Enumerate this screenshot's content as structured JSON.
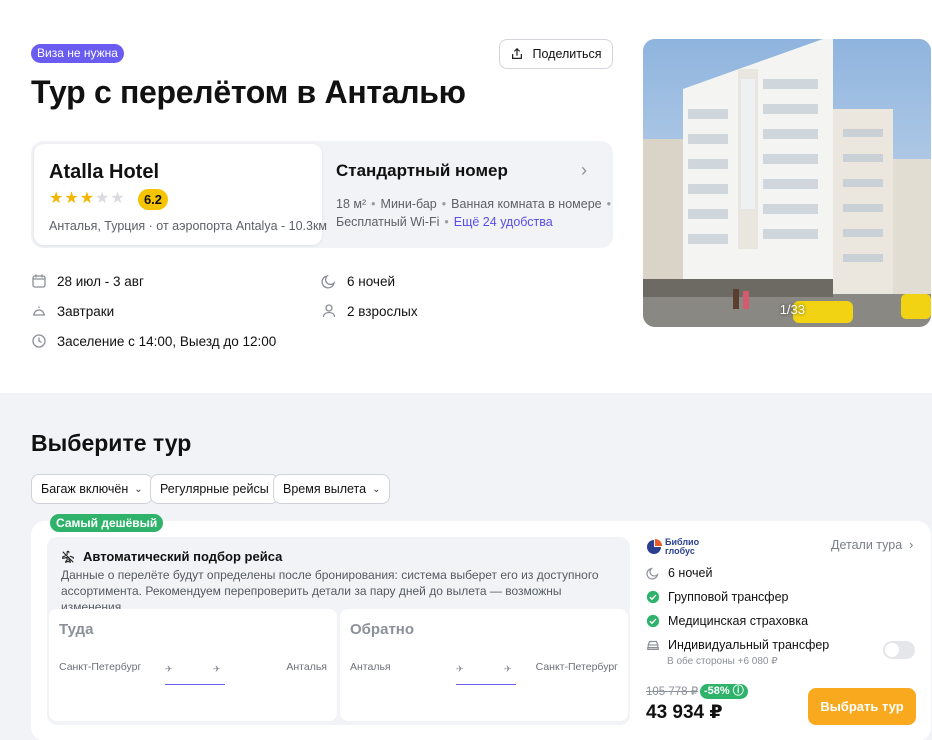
{
  "header": {
    "visa_badge": "Виза не нужна",
    "share_label": "Поделиться",
    "title": "Тур с перелётом в Анталью"
  },
  "hotel": {
    "name": "Atalla Hotel",
    "stars": 3,
    "stars_max": 5,
    "rating": "6.2",
    "location": "Анталья, Турция · от аэропорта Antalya - 10.3км"
  },
  "room": {
    "title": "Стандартный номер",
    "amenities_line1": [
      "18 м²",
      "Мини-бар",
      "Ванная комната в номере"
    ],
    "amenities_line2_text": "Бесплатный Wi-Fi",
    "more_amenities": "Ещё 24 удобства"
  },
  "trip": {
    "dates": "28 июл - 3 авг",
    "nights": "6 ночей",
    "meals": "Завтраки",
    "guests": "2 взрослых",
    "checkin": "Заселение с 14:00, Выезд до 12:00"
  },
  "photo": {
    "counter": "1/33"
  },
  "tours": {
    "section_title": "Выберите тур",
    "filters": [
      {
        "label": "Багаж включён",
        "has_dropdown": true
      },
      {
        "label": "Регулярные рейсы",
        "has_dropdown": false
      },
      {
        "label": "Время вылета",
        "has_dropdown": true
      }
    ],
    "card": {
      "badge": "Самый дешёвый",
      "flight_title": "Автоматический подбор рейса",
      "flight_desc": "Данные о перелёте будут определены после бронирования: система выберет его из доступного ассортимента. Рекомендуем перепроверить детали за пару дней до вылета — возможны изменения.",
      "legs": [
        {
          "title": "Туда",
          "from": "Санкт-Петербург",
          "to": "Анталья"
        },
        {
          "title": "Обратно",
          "from": "Анталья",
          "to": "Санкт-Петербург"
        }
      ],
      "operator_logo_line1": "Библио",
      "operator_logo_line2": "глобус",
      "details_link": "Детали тура",
      "features": [
        {
          "label": "6 ночей",
          "icon": "moon-icon"
        },
        {
          "label": "Групповой трансфер",
          "icon": "check-icon"
        },
        {
          "label": "Медицинская страховка",
          "icon": "check-icon"
        }
      ],
      "individual_transfer": "Индивидуальный трансфер",
      "individual_transfer_sub": "В обе стороны +6 080 ₽",
      "transfer_toggle_on": false,
      "old_price": "105 778 ₽",
      "discount": "-58%",
      "price": "43 934 ₽",
      "choose_label": "Выбрать тур"
    }
  },
  "colors": {
    "accent": "#6a5cf0",
    "green": "#2fb36b",
    "orange": "#f9a91d",
    "star": "#f2b600"
  }
}
